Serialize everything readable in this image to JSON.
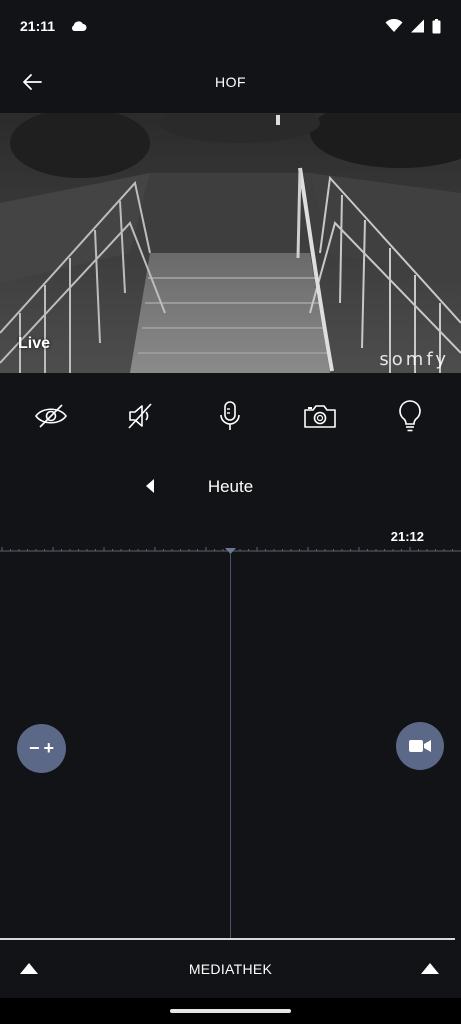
{
  "status_bar": {
    "time": "21:11",
    "icons": [
      "cloud-icon",
      "wifi-icon",
      "signal-icon",
      "battery-icon"
    ]
  },
  "app_bar": {
    "title": "HOF",
    "back_icon": "arrow-left-icon"
  },
  "camera": {
    "live_label": "Live",
    "watermark": "somfy"
  },
  "controls": [
    {
      "name": "privacy-button",
      "icon": "eye-off-icon"
    },
    {
      "name": "mute-button",
      "icon": "speaker-muted-icon"
    },
    {
      "name": "microphone-button",
      "icon": "microphone-icon"
    },
    {
      "name": "snapshot-button",
      "icon": "camera-icon"
    },
    {
      "name": "light-button",
      "icon": "lightbulb-icon"
    }
  ],
  "day_nav": {
    "label": "Heute",
    "prev_icon": "triangle-left-icon"
  },
  "timeline": {
    "current_time": "21:12",
    "zoom_label_minus": "−",
    "zoom_label_plus": "+",
    "record_icon": "video-camera-icon"
  },
  "bottom": {
    "label": "MEDIATHEK",
    "expand_icon": "triangle-up-icon"
  },
  "colors": {
    "background": "#121316",
    "fab": "#5b6888",
    "cursor_line": "#4a5466",
    "divider": "#d9d9d9"
  }
}
